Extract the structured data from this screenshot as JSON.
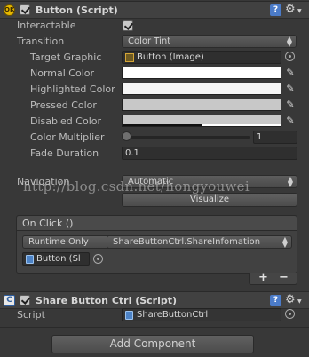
{
  "button_component": {
    "title": "Button (Script)",
    "enabled": true,
    "interactable_label": "Interactable",
    "interactable_checked": true,
    "transition_label": "Transition",
    "transition_value": "Color Tint",
    "target_graphic_label": "Target Graphic",
    "target_graphic_value": "Button (Image)",
    "normal_color_label": "Normal Color",
    "highlighted_color_label": "Highlighted Color",
    "pressed_color_label": "Pressed Color",
    "disabled_color_label": "Disabled Color",
    "colors": {
      "normal": "#ffffff",
      "highlighted": "#f5f5f5",
      "pressed": "#c8c8c8",
      "disabled": "#c8c8c8"
    },
    "color_multiplier_label": "Color Multiplier",
    "color_multiplier_value": "1",
    "fade_duration_label": "Fade Duration",
    "fade_duration_value": "0.1",
    "navigation_label": "Navigation",
    "navigation_value": "Automatic",
    "visualize_label": "Visualize"
  },
  "on_click": {
    "header": "On Click ()",
    "runtime_value": "Runtime Only",
    "function_value": "ShareButtonCtrl.ShareInfomation",
    "object_value": "Button (Sl",
    "add_label": "+",
    "remove_label": "−"
  },
  "share_component": {
    "title": "Share Button Ctrl (Script)",
    "enabled": true,
    "script_label": "Script",
    "script_value": "ShareButtonCtrl"
  },
  "add_component_label": "Add Component",
  "watermark": "http://blog.csdn.net/hongyouwei",
  "icons": {
    "ok_badge": "OK",
    "help_icon": "?",
    "gear_icon": "⚙"
  }
}
